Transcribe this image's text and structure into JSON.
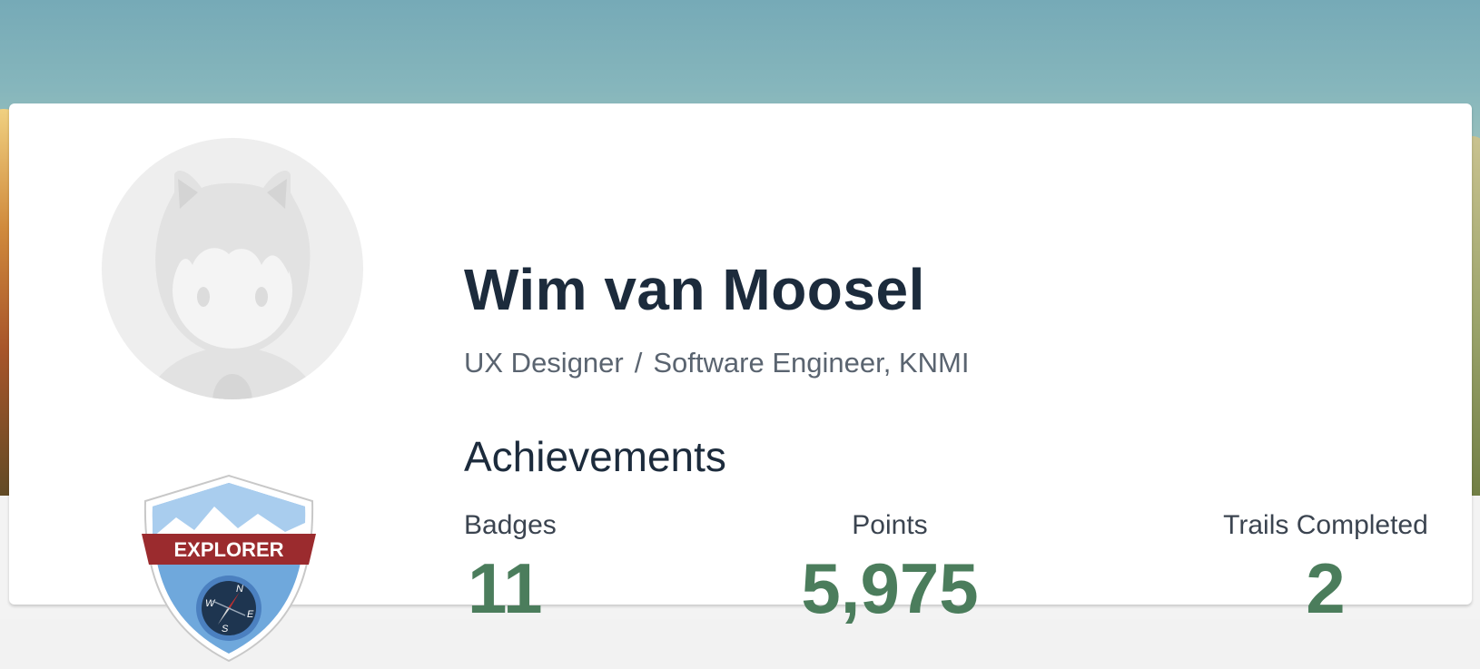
{
  "profile": {
    "name": "Wim van Moosel",
    "role": "UX Designer",
    "separator": "/",
    "company": "Software Engineer, KNMI"
  },
  "rank_badge": {
    "label": "EXPLORER",
    "icon": "compass-icon",
    "compass": {
      "n": "N",
      "e": "E",
      "s": "S",
      "w": "W"
    }
  },
  "achievements": {
    "title": "Achievements",
    "stats": [
      {
        "label": "Badges",
        "value": "11"
      },
      {
        "label": "Points",
        "value": "5,975"
      },
      {
        "label": "Trails Completed",
        "value": "2"
      }
    ]
  },
  "colors": {
    "accent_green": "#4b7d5c",
    "name_text": "#1c2b3c",
    "badge_ribbon": "#9b2b2e",
    "badge_sky": "#6fa8dc",
    "compass_dial": "#1e3550"
  }
}
